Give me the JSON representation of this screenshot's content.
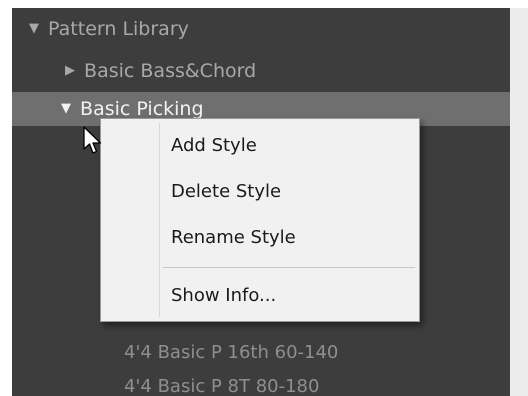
{
  "tree": {
    "root": {
      "label": "Pattern Library",
      "expanded": true
    },
    "items": [
      {
        "label": "Basic Bass&Chord",
        "expanded": false
      },
      {
        "label": "Basic Picking",
        "expanded": true,
        "selected": true
      }
    ],
    "leaves": [
      {
        "label": "4'4 Basic P 16th 60-140"
      },
      {
        "label": "4'4 Basic P 8T 80-180"
      }
    ]
  },
  "context_menu": {
    "items": [
      {
        "label": "Add Style"
      },
      {
        "label": "Delete Style"
      },
      {
        "label": "Rename Style"
      },
      {
        "label": "Show Info..."
      }
    ]
  },
  "icons": {
    "expanded": "triangle-down-icon",
    "collapsed": "triangle-right-icon",
    "cursor": "arrow-cursor-icon"
  },
  "colors": {
    "panel_bg": "#3d3d3d",
    "selected_row": "#6f6f6f",
    "menu_bg": "#f1f1f1"
  }
}
